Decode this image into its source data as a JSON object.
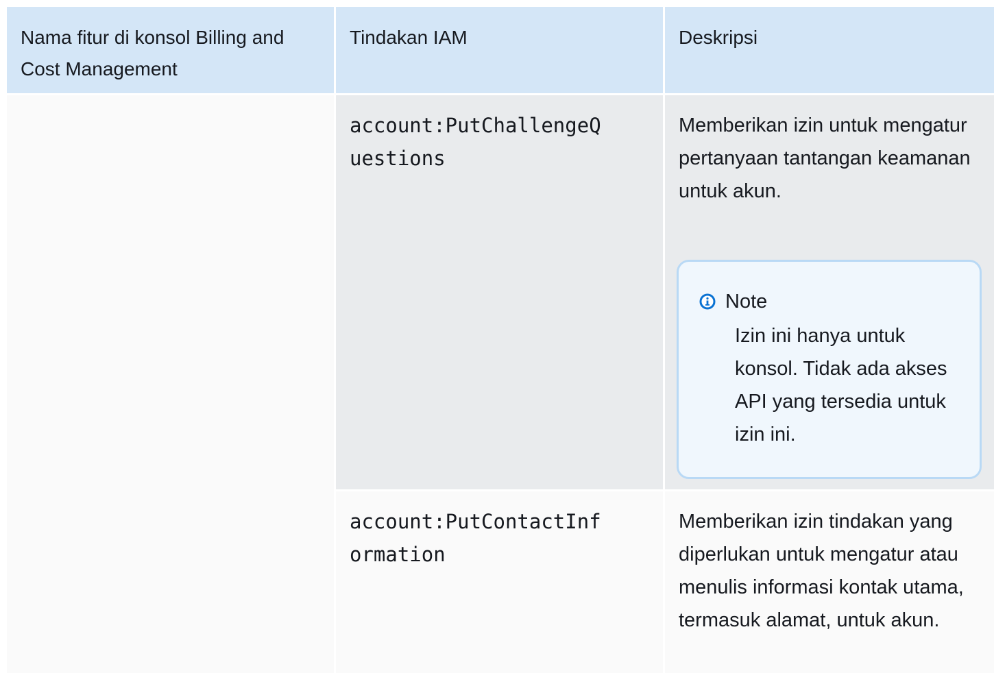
{
  "table": {
    "headers": [
      "Nama fitur di konsol Billing and Cost Management",
      "Tindakan IAM",
      "Deskripsi"
    ],
    "rows": [
      {
        "feature": "",
        "action": "account:PutChallengeQuestions",
        "description": "Memberikan izin untuk mengatur pertanyaan tantangan keamanan untuk akun.",
        "note": {
          "icon": "info-icon",
          "title": "Note",
          "text": "Izin ini hanya untuk konsol. Tidak ada akses API yang tersedia untuk izin ini."
        }
      },
      {
        "feature": "",
        "action": "account:PutContactInformation",
        "description": "Memberikan izin tindakan yang diperlukan untuk mengatur atau menulis informasi kontak utama, termasuk alamat, untuk akun."
      }
    ]
  },
  "colors": {
    "header_bg": "#d4e6f7",
    "row_highlight_bg": "#e9ebed",
    "note_border": "#b9d9f5",
    "note_icon": "#0972d3"
  }
}
